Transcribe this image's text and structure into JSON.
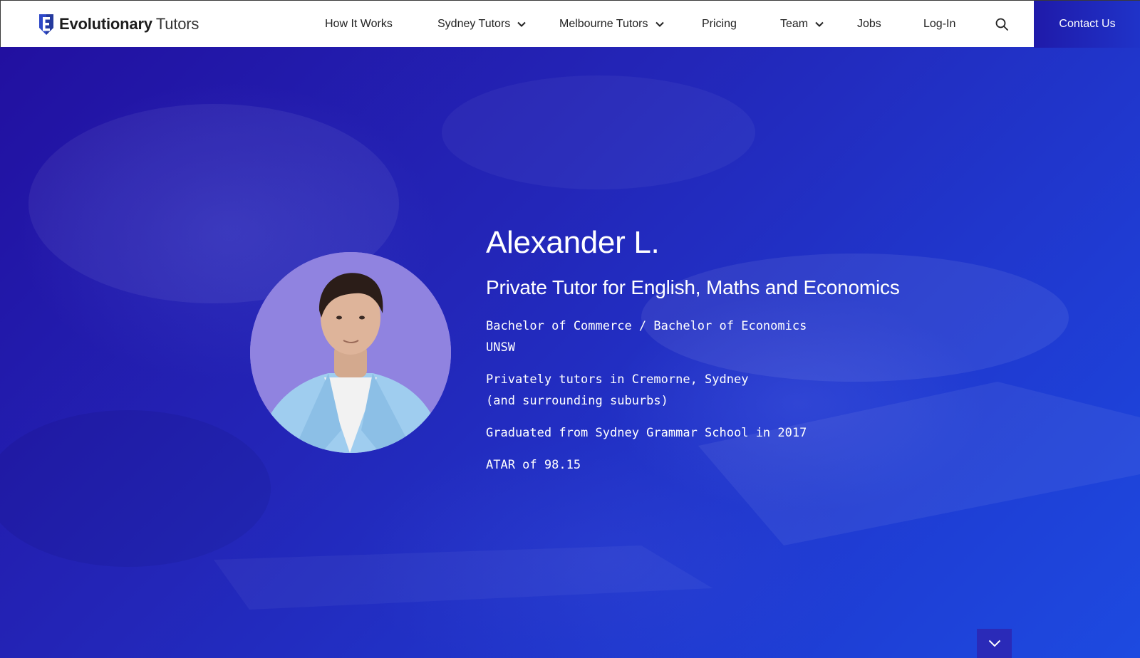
{
  "header": {
    "logo": {
      "bold": "Evolutionary",
      "light": "Tutors"
    },
    "nav": [
      {
        "label": "How It Works",
        "has_dropdown": false
      },
      {
        "label": "Sydney Tutors",
        "has_dropdown": true
      },
      {
        "label": "Melbourne Tutors",
        "has_dropdown": true
      },
      {
        "label": "Pricing",
        "has_dropdown": false
      },
      {
        "label": "Team",
        "has_dropdown": true
      },
      {
        "label": "Jobs",
        "has_dropdown": false
      },
      {
        "label": "Log-In",
        "has_dropdown": false
      }
    ],
    "search_icon": "search-icon",
    "contact_label": "Contact Us"
  },
  "profile": {
    "name": "Alexander L.",
    "title": "Private Tutor for English, Maths and Economics",
    "degree": "Bachelor of Commerce / Bachelor of Economics",
    "university": "UNSW",
    "location_line1": "Privately tutors in Cremorne, Sydney",
    "location_line2": "(and surrounding suburbs)",
    "graduated": "Graduated from Sydney Grammar School in 2017",
    "atar": "ATAR of 98.15"
  },
  "scroll_icon": "chevron-down-icon",
  "colors": {
    "brand_blue": "#2326b8",
    "contact_button": "#1f33c9",
    "avatar_bg": "#9083e0",
    "white": "#ffffff"
  }
}
